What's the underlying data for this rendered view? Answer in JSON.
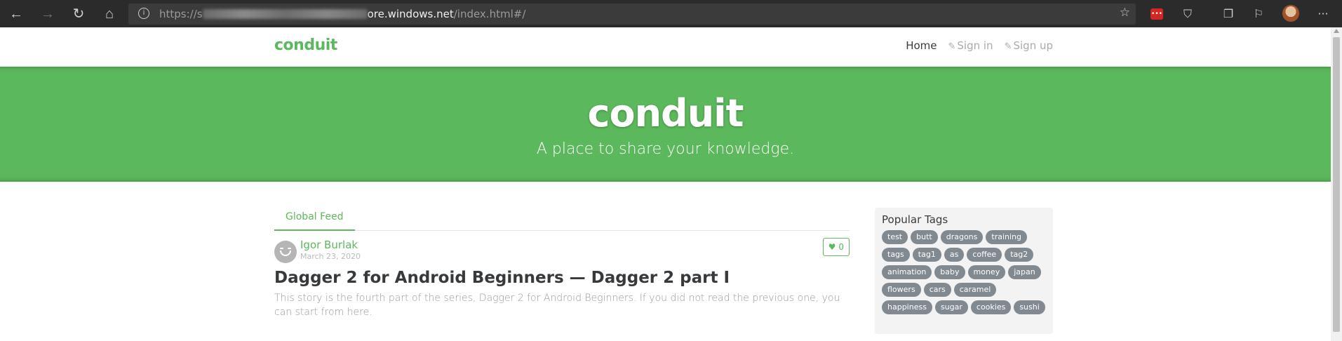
{
  "browser": {
    "url_prefix": "https://s",
    "url_host": "ore.windows.net",
    "url_path": "/index.html#/",
    "star_icon": "star-icon"
  },
  "navbar": {
    "brand": "conduit",
    "links": [
      {
        "label": "Home",
        "active": true
      },
      {
        "label": "Sign in",
        "icon": "edit-icon"
      },
      {
        "label": "Sign up",
        "icon": "edit-icon"
      }
    ]
  },
  "banner": {
    "title": "conduit",
    "subtitle": "A place to share your knowledge."
  },
  "feed": {
    "tab": "Global Feed"
  },
  "article": {
    "author": "Igor Burlak",
    "date": "March 23, 2020",
    "likes": "0",
    "title": "Dagger 2 for Android Beginners — Dagger 2 part I",
    "description": "This story is the fourth part of the series, Dagger 2 for Android Beginners. If you did not read the previous one, you can start from here."
  },
  "sidebar": {
    "title": "Popular Tags",
    "tags": [
      "test",
      "butt",
      "dragons",
      "training",
      "tags",
      "tag1",
      "as",
      "coffee",
      "tag2",
      "animation",
      "baby",
      "money",
      "japan",
      "flowers",
      "cars",
      "caramel",
      "happiness",
      "sugar",
      "cookies",
      "sushi"
    ]
  },
  "colors": {
    "brand": "#5cb85c",
    "tag_bg": "#818a91"
  }
}
